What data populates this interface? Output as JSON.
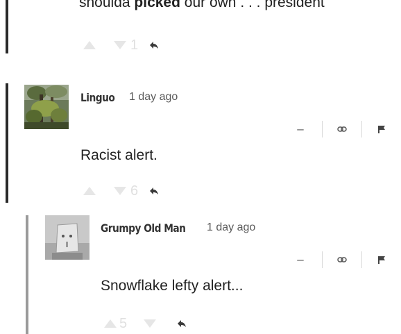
{
  "comments": [
    {
      "id": "c0",
      "body_prefix": "shoulda ",
      "body_bold": "picked",
      "body_suffix": " our own . . . president",
      "downvotes": "1"
    },
    {
      "id": "c1",
      "author": "Linguo",
      "timestamp": "1 day ago",
      "body": "Racist alert.",
      "downvotes": "6",
      "collapse_label": "–"
    },
    {
      "id": "c2",
      "author": "Grumpy Old Man",
      "timestamp": "1 day ago",
      "body": "Snowflake lefty alert...",
      "upvotes": "5",
      "collapse_label": "–"
    }
  ],
  "icons": {
    "upvote": "triangle-up",
    "downvote": "triangle-down",
    "reply": "reply-arrow-icon",
    "link": "link-icon",
    "flag": "flag-icon"
  },
  "colors": {
    "thread_bar_dark": "#2a2a2a",
    "thread_bar_light": "#9a9a9a",
    "vote_inactive": "#e3e3e3"
  }
}
